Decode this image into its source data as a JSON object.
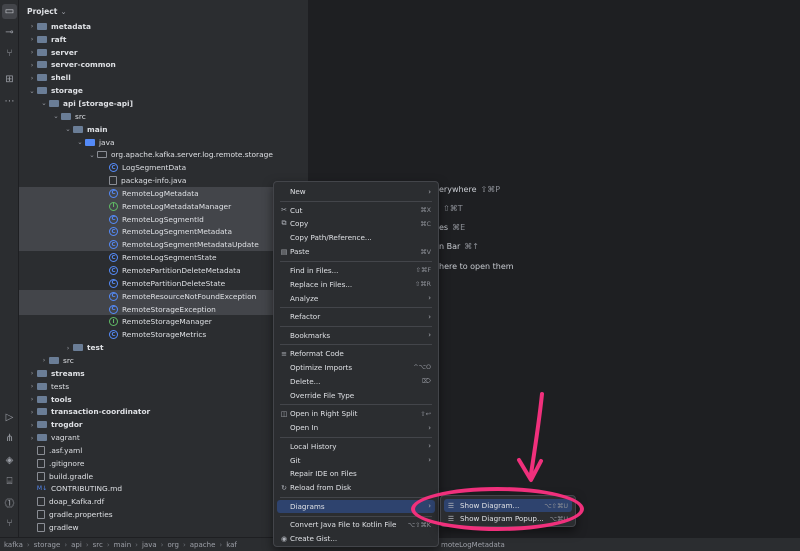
{
  "project_panel": {
    "title": "Project"
  },
  "tree": [
    {
      "label": "metadata",
      "indent": 1,
      "type": "folder",
      "arrow": "›",
      "bold": true
    },
    {
      "label": "raft",
      "indent": 1,
      "type": "folder",
      "arrow": "›",
      "bold": true
    },
    {
      "label": "server",
      "indent": 1,
      "type": "folder",
      "arrow": "›",
      "bold": true
    },
    {
      "label": "server-common",
      "indent": 1,
      "type": "folder",
      "arrow": "›",
      "bold": true
    },
    {
      "label": "shell",
      "indent": 1,
      "type": "folder",
      "arrow": "›",
      "bold": true
    },
    {
      "label": "storage",
      "indent": 1,
      "type": "folder",
      "arrow": "⌄",
      "bold": true
    },
    {
      "label": "api [storage-api]",
      "indent": 2,
      "type": "folder",
      "arrow": "⌄",
      "bold": true
    },
    {
      "label": "src",
      "indent": 3,
      "type": "folder",
      "arrow": "⌄",
      "bold": false
    },
    {
      "label": "main",
      "indent": 4,
      "type": "folder",
      "arrow": "⌄",
      "bold": true
    },
    {
      "label": "java",
      "indent": 5,
      "type": "folder-blue",
      "arrow": "⌄",
      "bold": false
    },
    {
      "label": "org.apache.kafka.server.log.remote.storage",
      "indent": 6,
      "type": "package",
      "arrow": "⌄",
      "bold": false
    },
    {
      "label": "LogSegmentData",
      "indent": 7,
      "type": "class",
      "arrow": "",
      "bold": false
    },
    {
      "label": "package-info.java",
      "indent": 7,
      "type": "file",
      "arrow": "",
      "bold": false
    },
    {
      "label": "RemoteLogMetadata",
      "indent": 7,
      "type": "class",
      "arrow": "",
      "bold": false,
      "sel": true
    },
    {
      "label": "RemoteLogMetadataManager",
      "indent": 7,
      "type": "interface",
      "arrow": "",
      "bold": false,
      "sel": true
    },
    {
      "label": "RemoteLogSegmentId",
      "indent": 7,
      "type": "class",
      "arrow": "",
      "bold": false,
      "sel": true
    },
    {
      "label": "RemoteLogSegmentMetadata",
      "indent": 7,
      "type": "class",
      "arrow": "",
      "bold": false,
      "sel": true
    },
    {
      "label": "RemoteLogSegmentMetadataUpdate",
      "indent": 7,
      "type": "class",
      "arrow": "",
      "bold": false,
      "sel": true
    },
    {
      "label": "RemoteLogSegmentState",
      "indent": 7,
      "type": "class",
      "arrow": "",
      "bold": false
    },
    {
      "label": "RemotePartitionDeleteMetadata",
      "indent": 7,
      "type": "class",
      "arrow": "",
      "bold": false
    },
    {
      "label": "RemotePartitionDeleteState",
      "indent": 7,
      "type": "class",
      "arrow": "",
      "bold": false
    },
    {
      "label": "RemoteResourceNotFoundException",
      "indent": 7,
      "type": "class",
      "arrow": "",
      "bold": false,
      "sel": true
    },
    {
      "label": "RemoteStorageException",
      "indent": 7,
      "type": "class",
      "arrow": "",
      "bold": false,
      "sel": true
    },
    {
      "label": "RemoteStorageManager",
      "indent": 7,
      "type": "interface",
      "arrow": "",
      "bold": false
    },
    {
      "label": "RemoteStorageMetrics",
      "indent": 7,
      "type": "class",
      "arrow": "",
      "bold": false
    },
    {
      "label": "test",
      "indent": 4,
      "type": "folder",
      "arrow": "›",
      "bold": true
    },
    {
      "label": "src",
      "indent": 2,
      "type": "folder",
      "arrow": "›",
      "bold": false
    },
    {
      "label": "streams",
      "indent": 1,
      "type": "folder",
      "arrow": "›",
      "bold": true
    },
    {
      "label": "tests",
      "indent": 1,
      "type": "folder",
      "arrow": "›",
      "bold": false
    },
    {
      "label": "tools",
      "indent": 1,
      "type": "folder",
      "arrow": "›",
      "bold": true
    },
    {
      "label": "transaction-coordinator",
      "indent": 1,
      "type": "folder",
      "arrow": "›",
      "bold": true
    },
    {
      "label": "trogdor",
      "indent": 1,
      "type": "folder",
      "arrow": "›",
      "bold": true
    },
    {
      "label": "vagrant",
      "indent": 1,
      "type": "folder",
      "arrow": "›",
      "bold": false
    },
    {
      "label": ".asf.yaml",
      "indent": 1,
      "type": "file",
      "arrow": "",
      "bold": false
    },
    {
      "label": ".gitignore",
      "indent": 1,
      "type": "file",
      "arrow": "",
      "bold": false
    },
    {
      "label": "build.gradle",
      "indent": 1,
      "type": "file",
      "arrow": "",
      "bold": false
    },
    {
      "label": "CONTRIBUTING.md",
      "indent": 1,
      "type": "md",
      "arrow": "",
      "bold": false
    },
    {
      "label": "doap_Kafka.rdf",
      "indent": 1,
      "type": "file",
      "arrow": "",
      "bold": false
    },
    {
      "label": "gradle.properties",
      "indent": 1,
      "type": "file",
      "arrow": "",
      "bold": false
    },
    {
      "label": "gradlew",
      "indent": 1,
      "type": "file",
      "arrow": "",
      "bold": false
    }
  ],
  "editor_hints": [
    {
      "text": "erywhere",
      "kbd": "⇧⌘P"
    },
    {
      "text": "",
      "kbd": "⇧⌘T"
    },
    {
      "text": "es",
      "kbd": "⌘E"
    },
    {
      "text": "n Bar",
      "kbd": "⌘↑"
    },
    {
      "text": "here to open them",
      "kbd": ""
    }
  ],
  "context_menu": [
    {
      "label": "New",
      "icon": "",
      "shortcut": "",
      "submenu": true
    },
    {
      "sep": true
    },
    {
      "label": "Cut",
      "icon": "✂",
      "shortcut": "⌘X"
    },
    {
      "label": "Copy",
      "icon": "⧉",
      "shortcut": "⌘C"
    },
    {
      "label": "Copy Path/Reference...",
      "icon": "",
      "shortcut": ""
    },
    {
      "label": "Paste",
      "icon": "▤",
      "shortcut": "⌘V"
    },
    {
      "sep": true
    },
    {
      "label": "Find in Files...",
      "icon": "",
      "shortcut": "⇧⌘F"
    },
    {
      "label": "Replace in Files...",
      "icon": "",
      "shortcut": "⇧⌘R"
    },
    {
      "label": "Analyze",
      "icon": "",
      "shortcut": "",
      "submenu": true
    },
    {
      "sep": true
    },
    {
      "label": "Refactor",
      "icon": "",
      "shortcut": "",
      "submenu": true
    },
    {
      "sep": true
    },
    {
      "label": "Bookmarks",
      "icon": "",
      "shortcut": "",
      "submenu": true
    },
    {
      "sep": true
    },
    {
      "label": "Reformat Code",
      "icon": "≡",
      "shortcut": ""
    },
    {
      "label": "Optimize Imports",
      "icon": "",
      "shortcut": "^⌥O"
    },
    {
      "label": "Delete...",
      "icon": "",
      "shortcut": "⌦"
    },
    {
      "label": "Override File Type",
      "icon": "",
      "shortcut": ""
    },
    {
      "sep": true
    },
    {
      "label": "Open in Right Split",
      "icon": "◫",
      "shortcut": "⇧↩"
    },
    {
      "label": "Open In",
      "icon": "",
      "shortcut": "",
      "submenu": true
    },
    {
      "sep": true
    },
    {
      "label": "Local History",
      "icon": "",
      "shortcut": "",
      "submenu": true
    },
    {
      "label": "Git",
      "icon": "",
      "shortcut": "",
      "submenu": true
    },
    {
      "label": "Repair IDE on Files",
      "icon": "",
      "shortcut": ""
    },
    {
      "label": "Reload from Disk",
      "icon": "↻",
      "shortcut": ""
    },
    {
      "sep": true
    },
    {
      "label": "Diagrams",
      "icon": "",
      "shortcut": "",
      "submenu": true,
      "highlight": true
    },
    {
      "sep": true
    },
    {
      "label": "Convert Java File to Kotlin File",
      "icon": "",
      "shortcut": "⌥⇧⌘K"
    },
    {
      "label": "Create Gist...",
      "icon": "◉",
      "shortcut": ""
    }
  ],
  "diagrams_submenu": [
    {
      "label": "Show Diagram...",
      "icon": "☰",
      "shortcut": "⌥⇧⌘U",
      "highlight": true
    },
    {
      "label": "Show Diagram Popup...",
      "icon": "☰",
      "shortcut": "⌥⌘U"
    }
  ],
  "status_bar": {
    "breadcrumbs": [
      "kafka",
      "storage",
      "api",
      "src",
      "main",
      "java",
      "org",
      "apache",
      "kaf"
    ],
    "tail": "moteLogMetadata"
  },
  "colors": {
    "accent": "#2e436e",
    "annotation": "#f0307c"
  }
}
